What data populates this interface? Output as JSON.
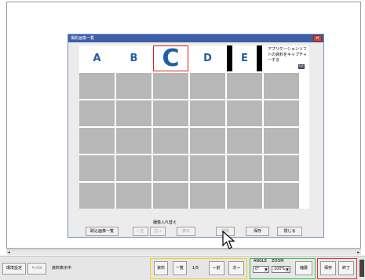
{
  "dialog": {
    "title": "撮影画像一覧",
    "close_label": "×",
    "letters": [
      "A",
      "B",
      "C",
      "D",
      "E"
    ],
    "info_text": "アプリケーションソフトの資料をキャプチャーする",
    "info_icon": "txt",
    "reorder_label": "撮像入れ替え",
    "buttons": {
      "import_list": "取込画像一覧",
      "left": "←左",
      "right": "右→",
      "display": "表示",
      "delete": "削除",
      "save": "保存",
      "close": "閉じる"
    }
  },
  "scrollbar": {
    "left_arrow": "◄",
    "right_arrow": "►"
  },
  "toolbar": {
    "env_settings": "環境設定",
    "cancel": "ｷｬﾝｾﾙ",
    "status": "資料表示中",
    "material": "資料",
    "list": "一覧",
    "page": "1/5",
    "prev": "←前",
    "next": "次→",
    "angle_label": "ANGLE",
    "zoom_label": "ZOOM",
    "angle_value": "0°",
    "zoom_value": "100%",
    "shrink": "縮層",
    "save": "保存",
    "end": "終了"
  },
  "colors": {
    "group_yellow": "#e8d31a",
    "group_green": "#37c24a",
    "group_red": "#e03030",
    "letter_blue": "#1f5fa6",
    "titlebar": "#3e5fa8"
  }
}
